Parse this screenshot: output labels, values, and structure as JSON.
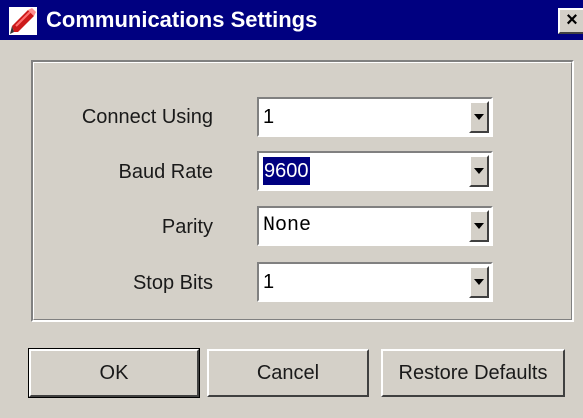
{
  "window": {
    "title": "Communications Settings",
    "close_glyph": "×",
    "icon": "red-pen-app-icon"
  },
  "fields": {
    "connect_using": {
      "label": "Connect Using",
      "value": "1"
    },
    "baud_rate": {
      "label": "Baud Rate",
      "value": "9600"
    },
    "parity": {
      "label": "Parity",
      "value": "None"
    },
    "stop_bits": {
      "label": "Stop Bits",
      "value": "1"
    }
  },
  "buttons": {
    "ok": "OK",
    "cancel": "Cancel",
    "restore_defaults": "Restore Defaults"
  },
  "colors": {
    "titlebar": "#000080",
    "dialog_face": "#d4d0c8",
    "selection": "#000080"
  }
}
